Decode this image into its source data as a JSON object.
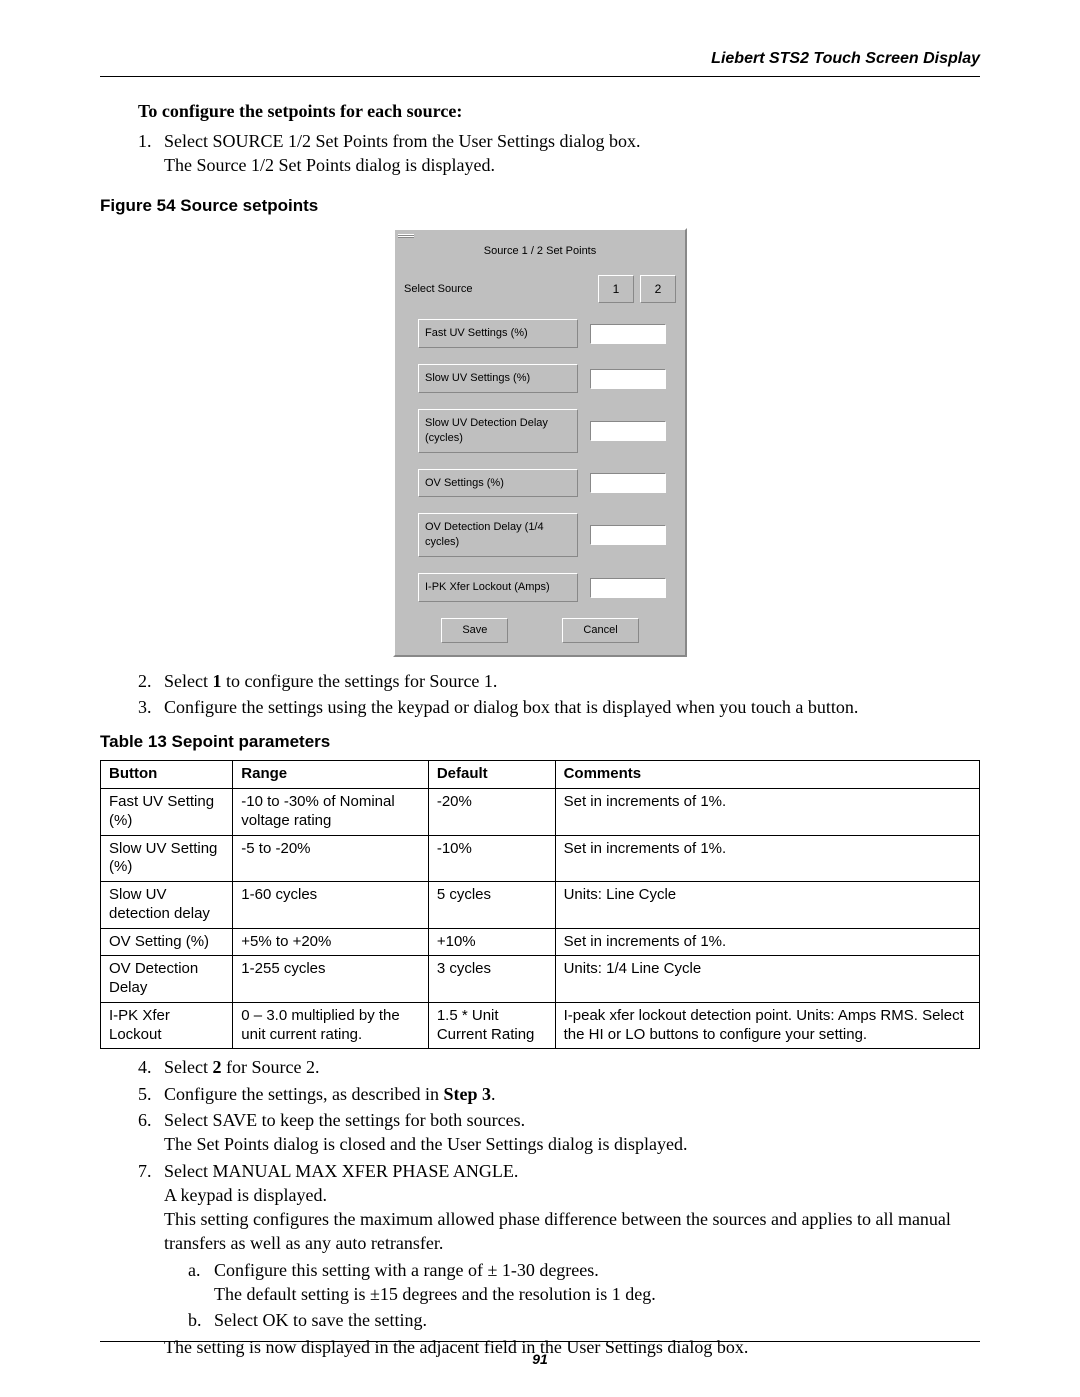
{
  "header": {
    "doc_title": "Liebert STS2 Touch Screen Display"
  },
  "intro": {
    "heading": "To configure the setpoints for each source:",
    "step1_a": "Select SOURCE 1/2 Set Points from the User Settings dialog box.",
    "step1_b": "The Source 1/2 Set Points dialog is displayed."
  },
  "figure_caption": "Figure 54  Source setpoints",
  "dialog": {
    "title": "Source 1 / 2 Set Points",
    "select_source": "Select Source",
    "btn1": "1",
    "btn2": "2",
    "rows": {
      "r0": "Fast UV Settings (%)",
      "r1": "Slow UV Settings (%)",
      "r2": "Slow UV Detection Delay (cycles)",
      "r3": "OV Settings (%)",
      "r4": "OV Detection Delay (1/4 cycles)",
      "r5": "I-PK Xfer Lockout (Amps)"
    },
    "save": "Save",
    "cancel": "Cancel"
  },
  "steps_mid": {
    "step2": "Select 1 to configure the settings for Source 1.",
    "step3": "Configure the settings using the keypad or dialog box that is displayed when you touch a button."
  },
  "table_caption": "Table 13     Sepoint parameters",
  "table": {
    "headers": {
      "button": "Button",
      "range": "Range",
      "default": "Default",
      "comments": "Comments"
    },
    "rows": [
      {
        "button": "Fast UV Setting (%)",
        "range": "-10 to -30% of Nominal voltage rating",
        "default": "-20%",
        "comments": "Set in increments of 1%."
      },
      {
        "button": "Slow UV Setting (%)",
        "range": "-5 to -20%",
        "default": "-10%",
        "comments": "Set in increments of 1%."
      },
      {
        "button": "Slow UV detection delay",
        "range": "1-60 cycles",
        "default": "5 cycles",
        "comments": "Units: Line Cycle"
      },
      {
        "button": "OV Setting (%)",
        "range": "+5% to +20%",
        "default": "+10%",
        "comments": "Set in increments of 1%."
      },
      {
        "button": "OV Detection Delay",
        "range": "1-255 cycles",
        "default": "3 cycles",
        "comments": "Units: 1/4 Line Cycle"
      },
      {
        "button": "I-PK Xfer Lockout",
        "range": "0 – 3.0 multiplied by the unit current rating.",
        "default": "1.5 * Unit Current Rating",
        "comments": "I-peak xfer lockout detection point. Units: Amps RMS. Select the HI or LO buttons to configure your setting."
      }
    ]
  },
  "steps_after": {
    "step4": "Select 2 for Source 2.",
    "step5_a": "Configure the settings, as described in ",
    "step5_b": "Step 3",
    "step5_c": ".",
    "step6_a": "Select SAVE to keep the settings for both sources.",
    "step6_b": "The Set Points dialog is closed and the User Settings dialog is displayed.",
    "step7_a": "Select MANUAL MAX XFER PHASE ANGLE.",
    "step7_b": "A keypad is displayed.",
    "step7_c": "This setting configures the maximum allowed phase difference between the sources and applies to all manual transfers as well as any auto retransfer.",
    "step7_sub_a1": "Configure this setting with a range of ± 1-30 degrees.",
    "step7_sub_a2": "The default setting is ±15 degrees and the resolution is 1 deg.",
    "step7_sub_b": "Select OK to save the setting.",
    "step7_d": "The setting is now displayed in the adjacent field in the User Settings dialog box."
  },
  "page_number": "91"
}
